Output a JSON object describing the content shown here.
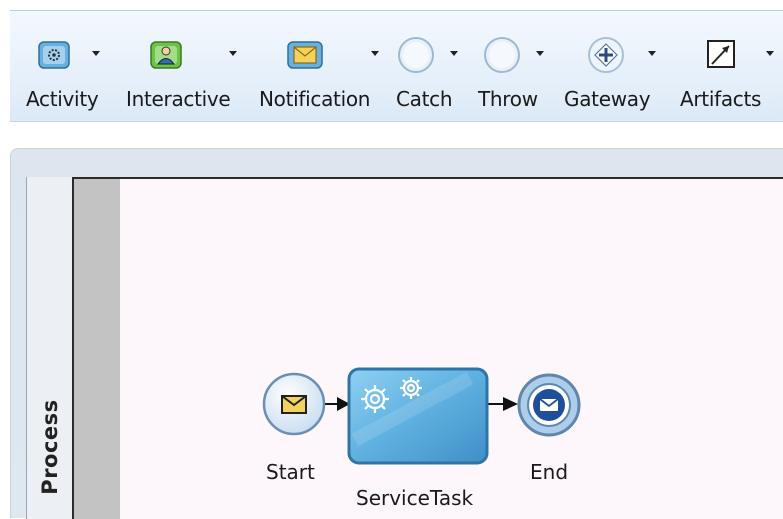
{
  "palette": {
    "items": [
      {
        "label": "Activity",
        "icon": "activity-icon"
      },
      {
        "label": "Interactive",
        "icon": "interactive-icon"
      },
      {
        "label": "Notification",
        "icon": "notification-icon"
      },
      {
        "label": "Catch",
        "icon": "catch-icon"
      },
      {
        "label": "Throw",
        "icon": "throw-icon"
      },
      {
        "label": "Gateway",
        "icon": "gateway-icon"
      },
      {
        "label": "Artifacts",
        "icon": "artifacts-icon"
      }
    ]
  },
  "swimlane": {
    "title": "Process"
  },
  "diagram": {
    "start": {
      "label": "Start",
      "icon": "message-start-event-icon"
    },
    "task": {
      "label": "ServiceTask",
      "icon": "service-task-gears-icon"
    },
    "end": {
      "label": "End",
      "icon": "message-end-event-icon"
    }
  },
  "colors": {
    "toolbar_bg": "#e6f0fa",
    "lane_bar": "#c3c3c3",
    "lane_body": "#fdf7fb",
    "task_fill": "#5fb0e0",
    "event_fill": "#d6e7f7"
  }
}
